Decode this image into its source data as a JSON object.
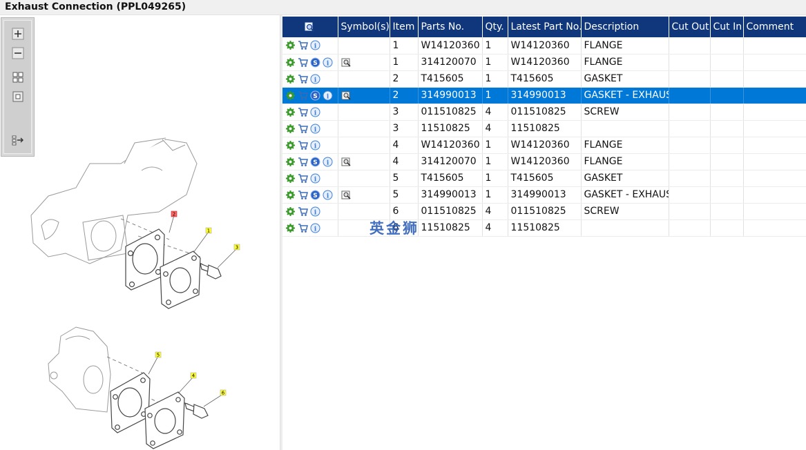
{
  "window": {
    "title": "Exhaust Connection (PPL049265)"
  },
  "toolbar": {
    "buttons": [
      {
        "icon": "zoom-in-icon"
      },
      {
        "icon": "zoom-out-icon"
      },
      {
        "icon": "fit-all-icon"
      },
      {
        "icon": "fit-window-icon"
      },
      {
        "icon": "toggle-layout-icon"
      }
    ]
  },
  "drawing": {
    "callouts": [
      "1",
      "2",
      "3",
      "4",
      "5",
      "6"
    ]
  },
  "table": {
    "columns": [
      "",
      "Symbol(s)",
      "Item",
      "Parts No.",
      "Qty.",
      "Latest Part No.",
      "Description",
      "Cut Out",
      "Cut In",
      "Comment"
    ],
    "rows": [
      {
        "s": false,
        "sym": false,
        "item": "1",
        "part": "W14120360",
        "qty": "1",
        "latest": "W14120360",
        "desc": "FLANGE"
      },
      {
        "s": true,
        "sym": true,
        "item": "1",
        "part": "314120070",
        "qty": "1",
        "latest": "W14120360",
        "desc": "FLANGE"
      },
      {
        "s": false,
        "sym": false,
        "item": "2",
        "part": "T415605",
        "qty": "1",
        "latest": "T415605",
        "desc": "GASKET"
      },
      {
        "s": true,
        "sym": true,
        "item": "2",
        "part": "314990013",
        "qty": "1",
        "latest": "314990013",
        "desc": "GASKET - EXHAUS",
        "selected": true
      },
      {
        "s": false,
        "sym": false,
        "item": "3",
        "part": "011510825",
        "qty": "4",
        "latest": "011510825",
        "desc": "SCREW"
      },
      {
        "s": false,
        "sym": false,
        "item": "3",
        "part": "11510825",
        "qty": "4",
        "latest": "11510825",
        "desc": ""
      },
      {
        "s": false,
        "sym": false,
        "item": "4",
        "part": "W14120360",
        "qty": "1",
        "latest": "W14120360",
        "desc": "FLANGE"
      },
      {
        "s": true,
        "sym": true,
        "item": "4",
        "part": "314120070",
        "qty": "1",
        "latest": "W14120360",
        "desc": "FLANGE"
      },
      {
        "s": false,
        "sym": false,
        "item": "5",
        "part": "T415605",
        "qty": "1",
        "latest": "T415605",
        "desc": "GASKET"
      },
      {
        "s": true,
        "sym": true,
        "item": "5",
        "part": "314990013",
        "qty": "1",
        "latest": "314990013",
        "desc": "GASKET - EXHAUS"
      },
      {
        "s": false,
        "sym": false,
        "item": "6",
        "part": "011510825",
        "qty": "4",
        "latest": "011510825",
        "desc": "SCREW"
      },
      {
        "s": false,
        "sym": false,
        "item": "6",
        "part": "11510825",
        "qty": "4",
        "latest": "11510825",
        "desc": ""
      }
    ]
  },
  "watermark": "英金狮",
  "colors": {
    "header": "#10367b",
    "selected": "#0078d7",
    "gear": "#3a9a2a",
    "info": "#3f7fd0"
  }
}
